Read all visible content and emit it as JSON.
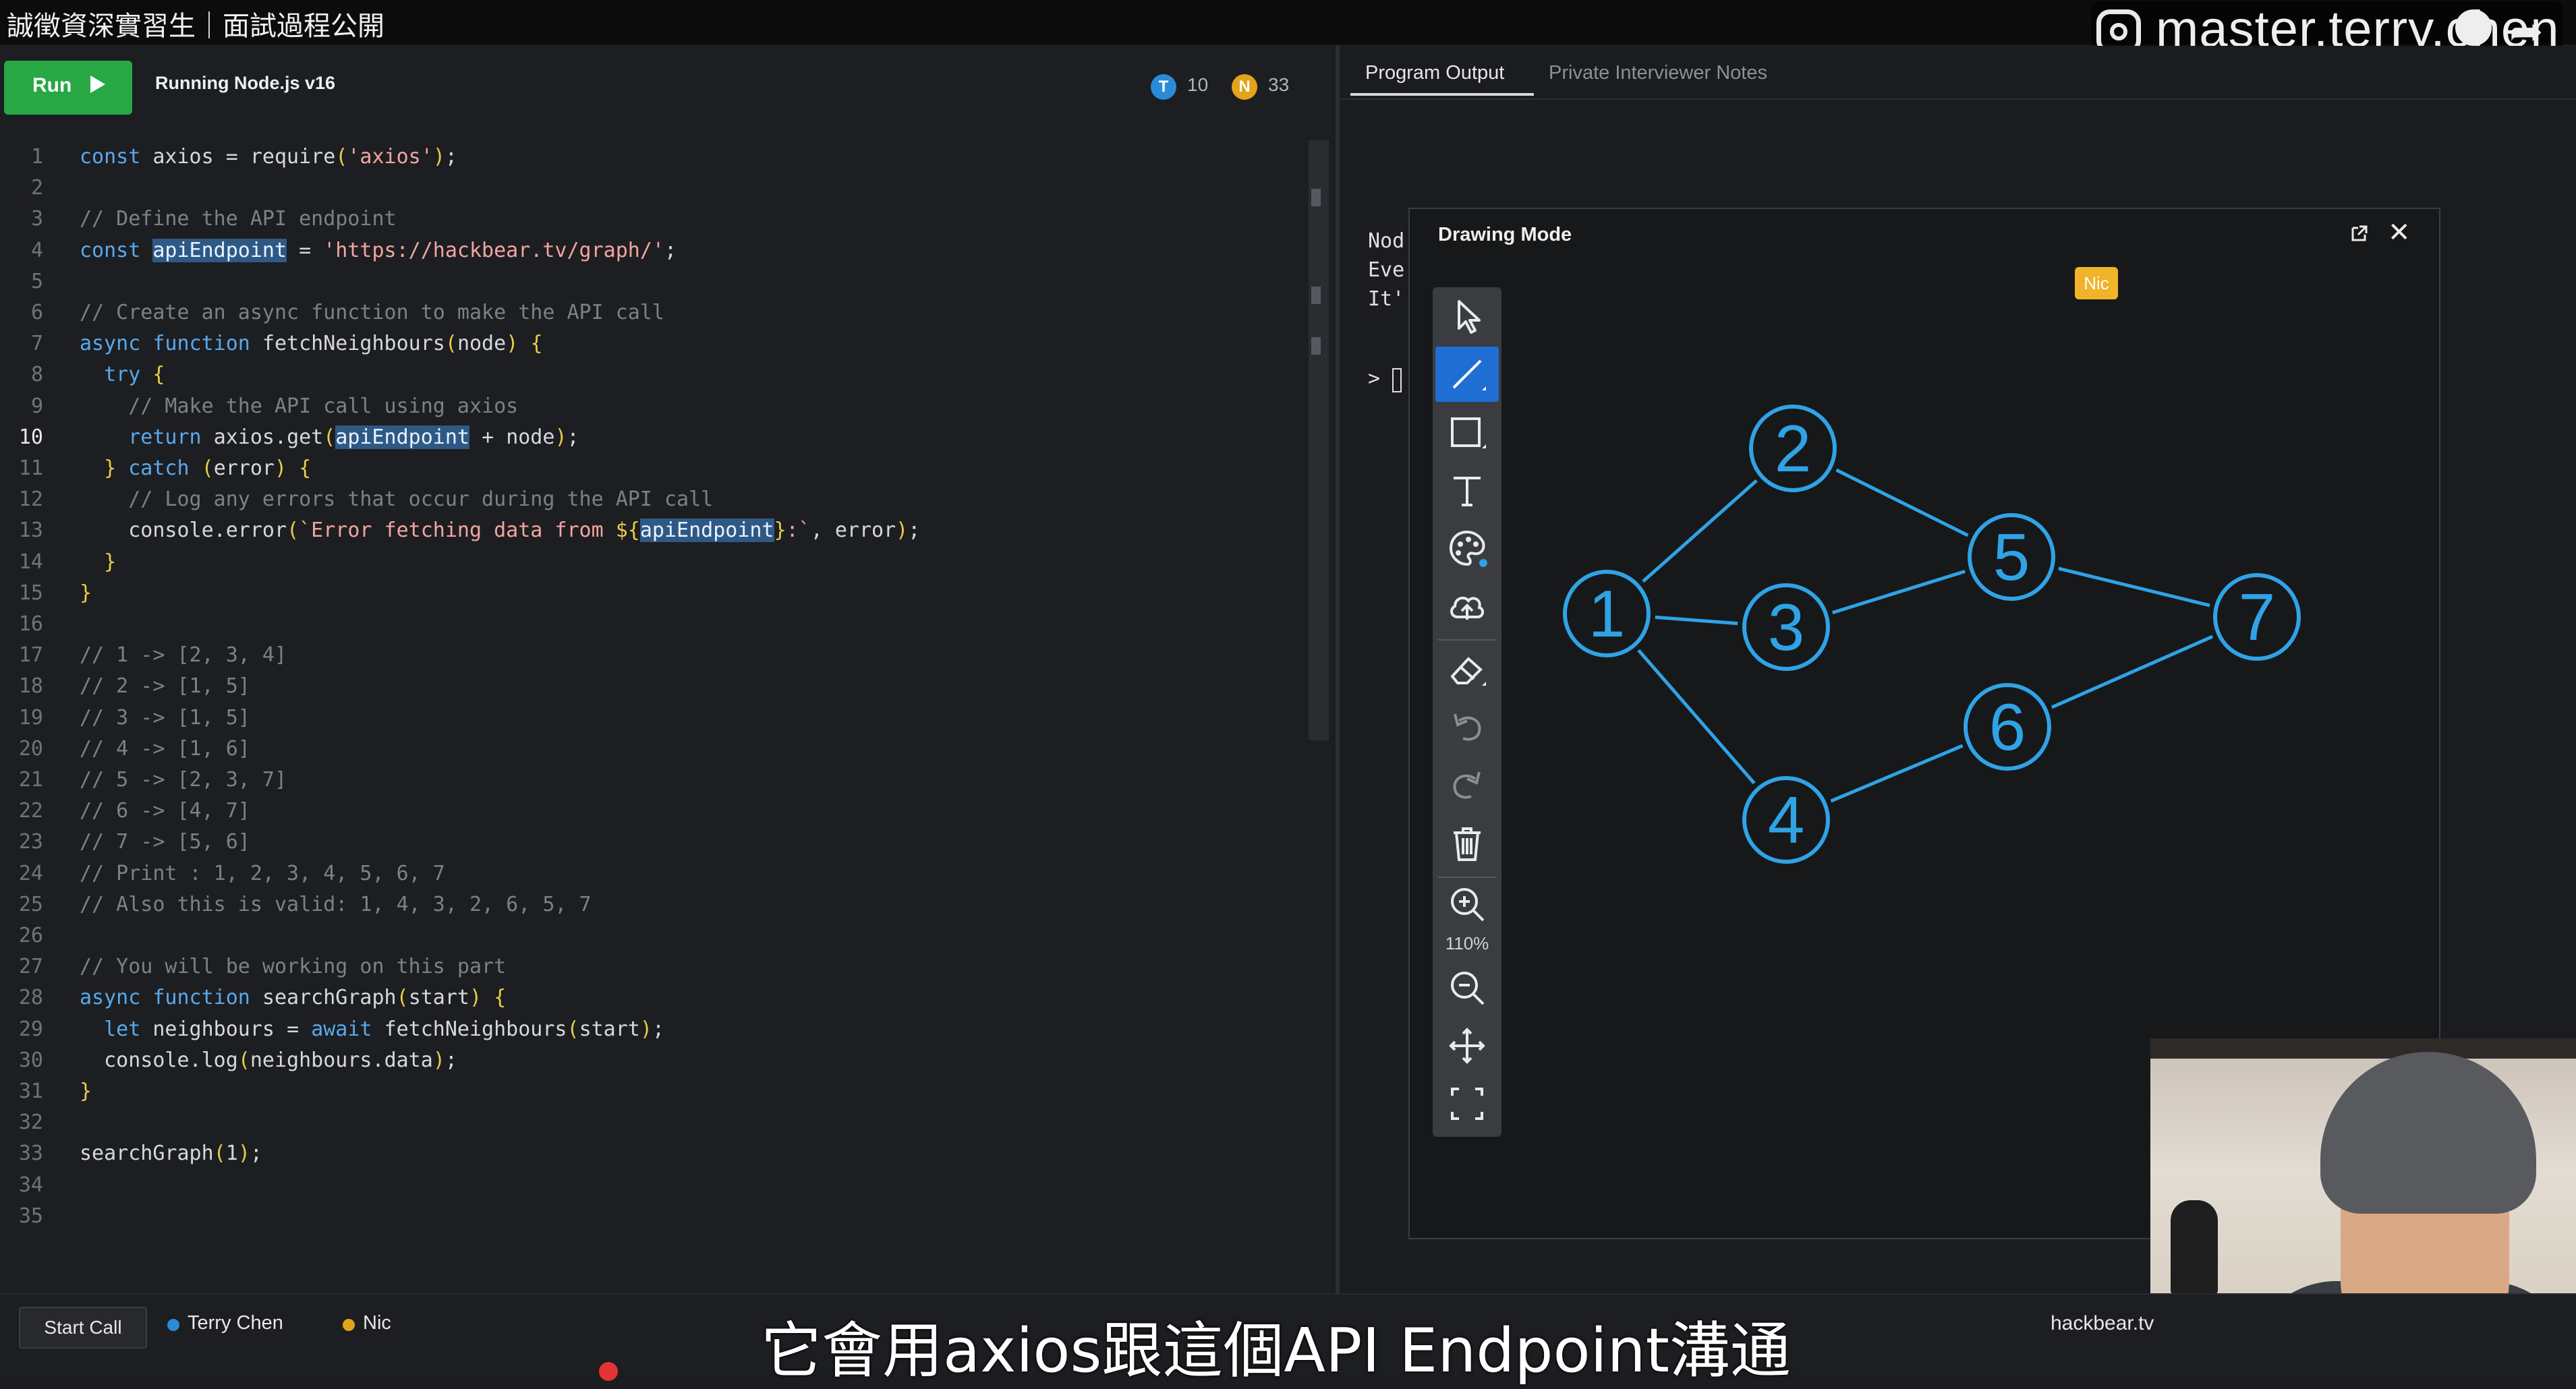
{
  "video": {
    "title": "誠徵資深實習生｜面試過程公開",
    "watermark": "master.terry.chen",
    "subtitle": "它會用axios跟這個API Endpoint溝通"
  },
  "toolbar": {
    "run_label": "Run",
    "runtime": "Running Node.js v16",
    "participants": [
      {
        "initial": "T",
        "count": "10",
        "color": "#2a8bd8"
      },
      {
        "initial": "N",
        "count": "33",
        "color": "#e3a419"
      }
    ]
  },
  "editor": {
    "active_line": 10,
    "lines": [
      "const axios = require('axios');",
      "",
      "// Define the API endpoint",
      "const apiEndpoint = 'https://hackbear.tv/graph/';",
      "",
      "// Create an async function to make the API call",
      "async function fetchNeighbours(node) {",
      "  try {",
      "    // Make the API call using axios",
      "    return axios.get(apiEndpoint + node);",
      "  } catch (error) {",
      "    // Log any errors that occur during the API call",
      "    console.error(`Error fetching data from ${apiEndpoint}:`, error);",
      "  }",
      "}",
      "",
      "// 1 -> [2, 3, 4]",
      "// 2 -> [1, 5]",
      "// 3 -> [1, 5]",
      "// 4 -> [1, 6]",
      "// 5 -> [2, 3, 7]",
      "// 6 -> [4, 7]",
      "// 7 -> [5, 6]",
      "// Print : 1, 2, 3, 4, 5, 6, 7",
      "// Also this is valid: 1, 4, 3, 2, 6, 5, 7",
      "",
      "// You will be working on this part",
      "async function searchGraph(start) {",
      "  let neighbours = await fetchNeighbours(start);",
      "  console.log(neighbours.data);",
      "}",
      "",
      "searchGraph(1);",
      "",
      ""
    ]
  },
  "output": {
    "tabs": [
      "Program Output",
      "Private Interviewer Notes"
    ],
    "active_tab": "Program Output",
    "lines": [
      "Nod",
      "Eve",
      "It'"
    ],
    "prompt": ">"
  },
  "drawing": {
    "title": "Drawing Mode",
    "cursor_label": "Nic",
    "zoom": "110%",
    "accent": "#2fa3e6",
    "tools": [
      "pointer-icon",
      "line-icon",
      "rectangle-icon",
      "text-icon",
      "palette-icon",
      "upload-icon",
      "eraser-icon",
      "undo-icon",
      "redo-icon",
      "trash-icon",
      "zoom-in-icon",
      "zoom-out-icon",
      "pan-icon",
      "fit-icon"
    ],
    "nodes": [
      {
        "label": "1"
      },
      {
        "label": "2"
      },
      {
        "label": "3"
      },
      {
        "label": "4"
      },
      {
        "label": "5"
      },
      {
        "label": "6"
      },
      {
        "label": "7"
      }
    ],
    "edges": [
      [
        "1",
        "2"
      ],
      [
        "1",
        "3"
      ],
      [
        "1",
        "4"
      ],
      [
        "2",
        "5"
      ],
      [
        "3",
        "5"
      ],
      [
        "4",
        "6"
      ],
      [
        "5",
        "7"
      ],
      [
        "6",
        "7"
      ]
    ]
  },
  "footer": {
    "start_call": "Start Call",
    "users": [
      "Terry Chen",
      "Nic"
    ],
    "brand": "hackbear.tv"
  }
}
